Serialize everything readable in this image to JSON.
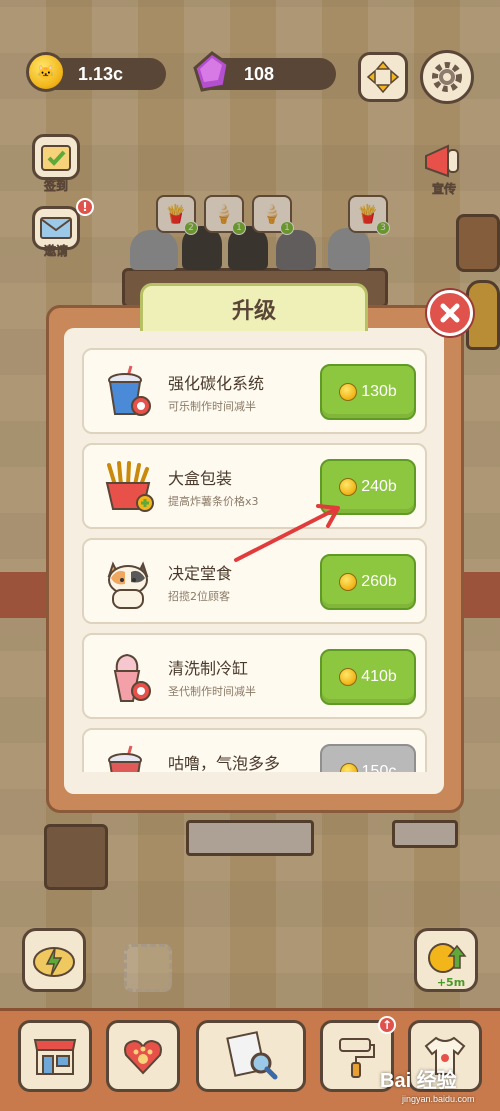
{
  "currency": {
    "coins": "1.13c",
    "gems": "108"
  },
  "side_buttons": {
    "checkin_label": "签到",
    "invite_label": "邀请",
    "promote_label": "宣传"
  },
  "customer_orders": [
    {
      "count": "2"
    },
    {
      "count": "1"
    },
    {
      "count": "1"
    },
    {
      "count": "3"
    }
  ],
  "modal": {
    "title": "升级",
    "items": [
      {
        "name": "强化碳化系统",
        "desc": "可乐制作时间减半",
        "price": "130b",
        "enabled": true,
        "icon": "soda-cup-icon"
      },
      {
        "name": "大盒包装",
        "desc": "提高炸薯条价格x3",
        "price": "240b",
        "enabled": true,
        "icon": "fries-icon"
      },
      {
        "name": "决定堂食",
        "desc": "招揽2位顾客",
        "price": "260b",
        "enabled": true,
        "icon": "cat-customer-icon"
      },
      {
        "name": "清洗制冷缸",
        "desc": "圣代制作时间减半",
        "price": "410b",
        "enabled": true,
        "icon": "sundae-icon"
      },
      {
        "name": "咕噜，气泡多多",
        "desc": "",
        "price": "150c",
        "enabled": false,
        "icon": "soda-cup-icon"
      }
    ]
  },
  "boost": {
    "label": "+5m"
  },
  "watermark": {
    "brand": "Bai 经验",
    "url": "jingyan.baidu.com"
  },
  "colors": {
    "accent_green": "#8dc63f",
    "close_red": "#e0524c",
    "frame": "#5a4637"
  }
}
